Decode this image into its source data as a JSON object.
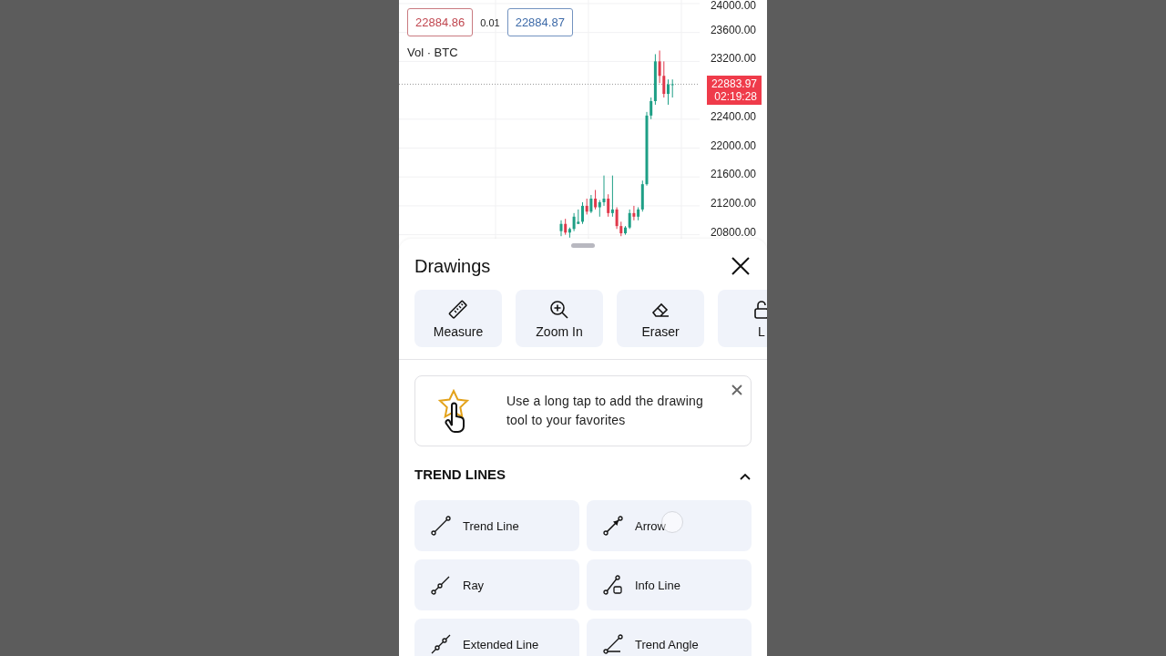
{
  "chart": {
    "bid": "22884.86",
    "spread": "0.01",
    "ask": "22884.87",
    "indicator": "Vol · BTC",
    "countdown": "02:19:28",
    "chart_data": {
      "type": "candlestick",
      "ohlc": [
        [
          20850,
          21000,
          20780,
          20950
        ],
        [
          20950,
          21020,
          20800,
          20830
        ],
        [
          20830,
          20900,
          20760,
          20880
        ],
        [
          20880,
          21100,
          20850,
          21050
        ],
        [
          20950,
          21150,
          20950,
          20980
        ],
        [
          20980,
          21250,
          20950,
          21200
        ],
        [
          21200,
          21300,
          21080,
          21120
        ],
        [
          21120,
          21350,
          21100,
          21300
        ],
        [
          21300,
          21420,
          21150,
          21180
        ],
        [
          21180,
          21280,
          21050,
          21250
        ],
        [
          21250,
          21620,
          21200,
          21300
        ],
        [
          21300,
          21360,
          21050,
          21100
        ],
        [
          21100,
          21620,
          21050,
          21150
        ],
        [
          21150,
          21180,
          20880,
          20920
        ],
        [
          20920,
          20980,
          20780,
          20820
        ],
        [
          20820,
          20920,
          20800,
          20900
        ],
        [
          20900,
          21150,
          20880,
          21100
        ],
        [
          21100,
          21200,
          21000,
          21050
        ],
        [
          21050,
          21180,
          21000,
          21150
        ],
        [
          21150,
          21550,
          21120,
          21500
        ],
        [
          21500,
          22500,
          21480,
          22450
        ],
        [
          22450,
          22700,
          22400,
          22650
        ],
        [
          22650,
          23300,
          22600,
          23200
        ],
        [
          23200,
          23350,
          22900,
          23000
        ],
        [
          23000,
          23200,
          22700,
          22750
        ],
        [
          22750,
          22950,
          22600,
          22880
        ],
        [
          22880,
          22950,
          22700,
          22884
        ]
      ],
      "ylim": [
        20745,
        24050
      ],
      "grid": true,
      "ref_lines": [
        {
          "axis": "y",
          "value": 22883.97,
          "label": "22883.97"
        }
      ],
      "yticks": [
        {
          "value": 24000,
          "label": "24000.00"
        },
        {
          "value": 23600,
          "label": "23600.00"
        },
        {
          "value": 23200,
          "label": "23200.00"
        },
        {
          "value": 22400,
          "label": "22400.00"
        },
        {
          "value": 22000,
          "label": "22000.00"
        },
        {
          "value": 21600,
          "label": "21600.00"
        },
        {
          "value": 21200,
          "label": "21200.00"
        },
        {
          "value": 20800,
          "label": "20800.00"
        }
      ]
    }
  },
  "sheet": {
    "title": "Drawings",
    "tools": [
      {
        "kind": "ruler",
        "label": "Measure"
      },
      {
        "kind": "zoom",
        "label": "Zoom In"
      },
      {
        "kind": "eraser",
        "label": "Eraser"
      },
      {
        "kind": "lock",
        "label": "L"
      }
    ],
    "tip": "Use a long tap to add the drawing tool to your favorites",
    "section": {
      "title": "TREND LINES",
      "expanded": true,
      "items": [
        {
          "kind": "trend",
          "label": "Trend Line"
        },
        {
          "kind": "arrow",
          "label": "Arrow"
        },
        {
          "kind": "ray",
          "label": "Ray"
        },
        {
          "kind": "info",
          "label": "Info Line"
        },
        {
          "kind": "extended",
          "label": "Extended Line"
        },
        {
          "kind": "angle",
          "label": "Trend Angle"
        }
      ]
    }
  }
}
